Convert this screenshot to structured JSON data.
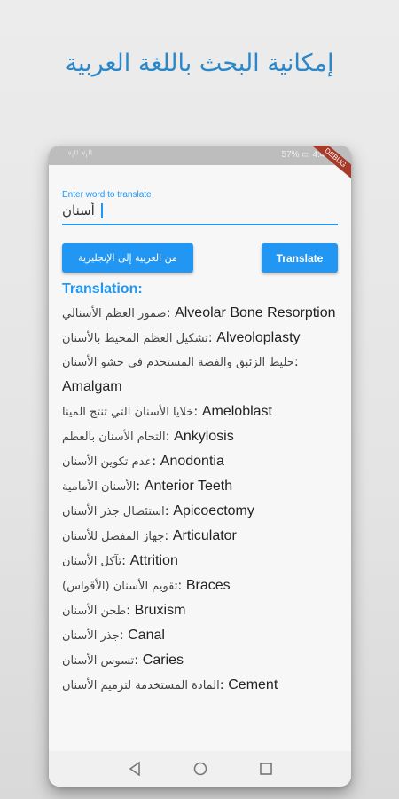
{
  "promo": {
    "headline": "إمكانية البحث باللغة العربية"
  },
  "status_bar": {
    "left": "ᵛᵢˡˡ ᵛᵢˡˡ",
    "right": "57% ▭ 4:40"
  },
  "debug_banner": "DEBUG",
  "input": {
    "label": "Enter word to translate",
    "value": "أسنان"
  },
  "buttons": {
    "direction_label": "من العربية إلى الإنجليزية",
    "translate_label": "Translate"
  },
  "translation": {
    "heading": "Translation:",
    "results": [
      {
        "ar": "ضمور العظم الأسنالي",
        "en": "Alveolar Bone Resorption"
      },
      {
        "ar": "تشكيل العظم المحيط بالأسنان",
        "en": "Alveoloplasty"
      },
      {
        "ar": "خليط الزئبق والفضة المستخدم في حشو الأسنان",
        "en": "Amalgam"
      },
      {
        "ar": "خلايا الأسنان التي تنتج المينا",
        "en": "Ameloblast"
      },
      {
        "ar": "التحام الأسنان بالعظم",
        "en": "Ankylosis"
      },
      {
        "ar": "عدم تكوين الأسنان",
        "en": "Anodontia"
      },
      {
        "ar": "الأسنان الأمامية",
        "en": "Anterior Teeth"
      },
      {
        "ar": "استئصال جذر الأسنان",
        "en": "Apicoectomy"
      },
      {
        "ar": "جهاز المفصل للأسنان",
        "en": "Articulator"
      },
      {
        "ar": "تآكل الأسنان",
        "en": "Attrition"
      },
      {
        "ar": "تقويم الأسنان (الأقواس)",
        "en": "Braces"
      },
      {
        "ar": "طحن الأسنان",
        "en": "Bruxism"
      },
      {
        "ar": "جذر الأسنان",
        "en": "Canal"
      },
      {
        "ar": "تسوس الأسنان",
        "en": "Caries"
      },
      {
        "ar": "المادة المستخدمة لترميم الأسنان",
        "en": "Cement"
      }
    ]
  },
  "nav": {
    "back_icon": "triangle-back",
    "home_icon": "circle-home",
    "recents_icon": "square-recents"
  },
  "colors": {
    "accent": "#2196f3",
    "headline": "#2a87c9"
  }
}
